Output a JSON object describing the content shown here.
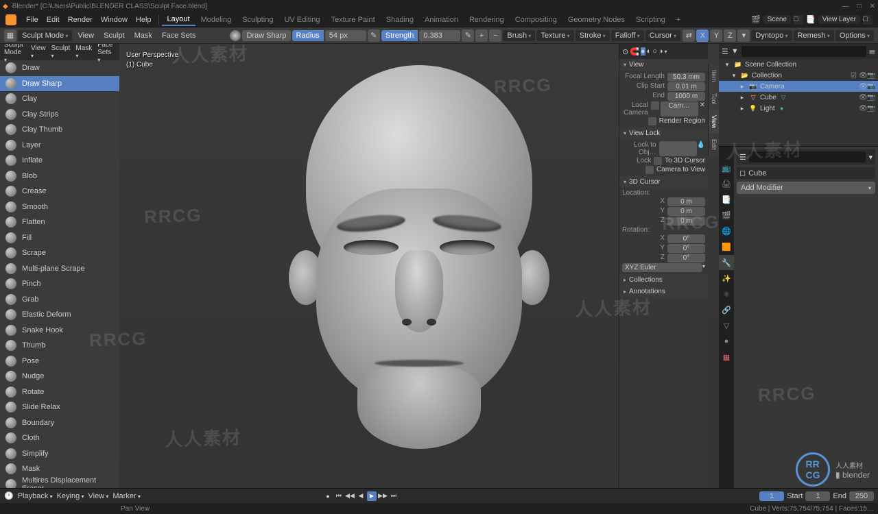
{
  "title": "Blender* [C:\\Users\\Public\\BLENDER CLASS\\Sculpt Face.blend]",
  "window_controls": {
    "min": "—",
    "max": "□",
    "close": "✕"
  },
  "menubar": {
    "menus": [
      "File",
      "Edit",
      "Render",
      "Window",
      "Help"
    ],
    "tabs": [
      "Layout",
      "Modeling",
      "Sculpting",
      "UV Editing",
      "Texture Paint",
      "Shading",
      "Animation",
      "Rendering",
      "Compositing",
      "Geometry Nodes",
      "Scripting"
    ],
    "add_tab": "+",
    "active_tab": 0,
    "scene_label": "Scene",
    "viewlayer_label": "View Layer"
  },
  "toolbar": {
    "mode": "Sculpt Mode",
    "menus": [
      "View",
      "Sculpt",
      "Mask",
      "Face Sets"
    ],
    "brush_name": "Draw Sharp",
    "radius_label": "Radius",
    "radius_value": "54 px",
    "strength_label": "Strength",
    "strength_value": "0.383",
    "dropdowns": [
      "Brush",
      "Texture",
      "Stroke",
      "Falloff",
      "Cursor"
    ],
    "right_menus": [
      "Dyntopo",
      "Remesh",
      "Options"
    ],
    "axis": [
      "X",
      "Y",
      "Z"
    ]
  },
  "brushes": [
    "Draw",
    "Draw Sharp",
    "Clay",
    "Clay Strips",
    "Clay Thumb",
    "Layer",
    "Inflate",
    "Blob",
    "Crease",
    "Smooth",
    "Flatten",
    "Fill",
    "Scrape",
    "Multi-plane Scrape",
    "Pinch",
    "Grab",
    "Elastic Deform",
    "Snake Hook",
    "Thumb",
    "Pose",
    "Nudge",
    "Rotate",
    "Slide Relax",
    "Boundary",
    "Cloth",
    "Simplify",
    "Mask",
    "Multires Displacement Eraser"
  ],
  "active_brush": 1,
  "viewport": {
    "info1": "User Perspective",
    "info2": "(1) Cube"
  },
  "npanel": {
    "tabs": [
      "Item",
      "Tool",
      "View",
      "Edit"
    ],
    "view": {
      "title": "View",
      "focal_label": "Focal Length",
      "focal": "50.3 mm",
      "clip_start_label": "Clip Start",
      "clip_start": "0.01 m",
      "clip_end_label": "End",
      "clip_end": "1000 m",
      "local_cam_label": "Local Camera",
      "local_cam": "Cam…",
      "render_region": "Render Region"
    },
    "viewlock": {
      "title": "View Lock",
      "lock_obj": "Lock to Obj…",
      "lock_label": "Lock",
      "to_cursor": "To 3D Cursor",
      "cam_to_view": "Camera to View"
    },
    "cursor3d": {
      "title": "3D Cursor",
      "location": "Location:",
      "rotation": "Rotation:",
      "x": "X",
      "y": "Y",
      "z": "Z",
      "loc_x": "0 m",
      "loc_y": "0 m",
      "loc_z": "0 m",
      "rot_x": "0°",
      "rot_y": "0°",
      "rot_z": "0°",
      "euler": "XYZ Euler"
    },
    "collections": "Collections",
    "annotations": "Annotations"
  },
  "outliner": {
    "scene_collection": "Scene Collection",
    "collection": "Collection",
    "items": [
      "Camera",
      "Cube",
      "Light"
    ],
    "selected": 0
  },
  "properties": {
    "object": "Cube",
    "add_modifier": "Add Modifier"
  },
  "timeline": {
    "menus": [
      "Playback",
      "Keying",
      "View",
      "Marker"
    ],
    "current": "1",
    "start_label": "Start",
    "start": "1",
    "end_label": "End",
    "end": "250"
  },
  "status": {
    "left": "Pan View",
    "right": "Cube | Verts:75,754/75,754 | Faces:15…"
  }
}
